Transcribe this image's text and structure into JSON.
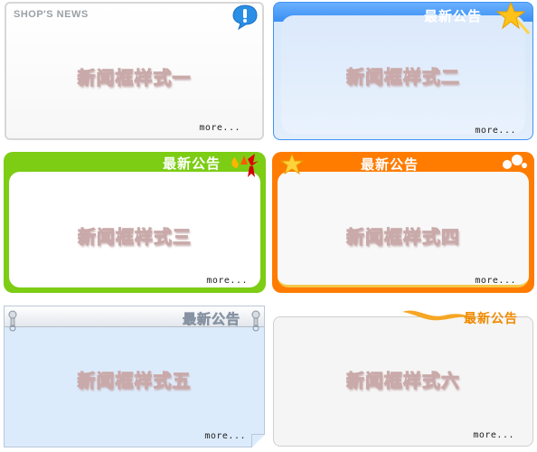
{
  "boxes": [
    {
      "caption": "新闻框样式一",
      "header": "SHOP'S NEWS",
      "more": "more..."
    },
    {
      "caption": "新闻框样式二",
      "header": "最新公告",
      "more": "more..."
    },
    {
      "caption": "新闻框样式三",
      "header": "最新公告",
      "more": "more..."
    },
    {
      "caption": "新闻框样式四",
      "header": "最新公告",
      "more": "more..."
    },
    {
      "caption": "新闻框样式五",
      "header": "最新公告",
      "more": "more..."
    },
    {
      "caption": "新闻框样式六",
      "header": "最新公告",
      "more": "more..."
    }
  ],
  "colors": {
    "blue": "#3f93f5",
    "green": "#7ccd14",
    "orange": "#ff7c00",
    "gold": "#f08a00"
  },
  "icons": [
    "speech-bubble-exclamation-icon",
    "shooting-star-icon",
    "bow-ribbon-icon",
    "star-ribbon-icon",
    "pin-clip-icon",
    "swoosh-icon"
  ]
}
